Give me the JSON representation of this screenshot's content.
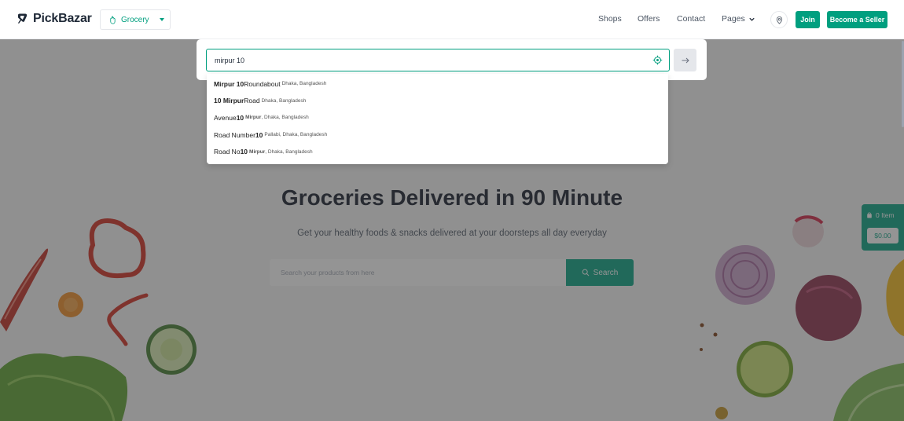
{
  "header": {
    "logo_text": "PickBazar",
    "shop_type": "Grocery",
    "nav": [
      "Shops",
      "Offers",
      "Contact",
      "Pages"
    ],
    "join_label": "Join",
    "seller_label": "Become a Seller"
  },
  "hero": {
    "title": "Groceries Delivered in 90 Minute",
    "subtitle": "Get your healthy foods & snacks delivered at your doorsteps all day everyday",
    "search_placeholder": "Search your products from here",
    "search_button": "Search"
  },
  "cart": {
    "count": "0 Item",
    "price": "$0.00"
  },
  "location_modal": {
    "input_value": "mirpur 10",
    "suggestions": [
      {
        "main_bold": "Mirpur 10",
        "main_rest": " Roundabout",
        "secondary": [
          {
            "t": "Dhaka, Bangladesh",
            "b": false
          }
        ]
      },
      {
        "main_bold": "10 Mirpur",
        "main_rest": " Road",
        "secondary": [
          {
            "t": "Dhaka, Bangladesh",
            "b": false
          }
        ]
      },
      {
        "main_pre": "Avenue ",
        "main_bold": "10",
        "main_rest": "",
        "secondary": [
          {
            "t": "Mirpur",
            "b": true
          },
          {
            "t": ", Dhaka, Bangladesh",
            "b": false
          }
        ]
      },
      {
        "main_pre": "Road Number ",
        "main_bold": "10",
        "main_rest": "",
        "secondary": [
          {
            "t": "Pallabi, Dhaka, Bangladesh",
            "b": false
          }
        ]
      },
      {
        "main_pre": "Road No ",
        "main_bold": "10",
        "main_rest": "",
        "secondary": [
          {
            "t": "Mirpur",
            "b": true
          },
          {
            "t": ", Dhaka, Bangladesh",
            "b": false
          }
        ]
      }
    ]
  },
  "colors": {
    "accent": "#009f7f",
    "overlay": "rgba(60,60,60,0.55)"
  },
  "icons": [
    "logo-icon",
    "grocery-icon",
    "chevron-down-icon",
    "map-pin-icon",
    "search-icon",
    "shopping-bag-icon",
    "target-location-icon",
    "arrow-right-icon"
  ]
}
